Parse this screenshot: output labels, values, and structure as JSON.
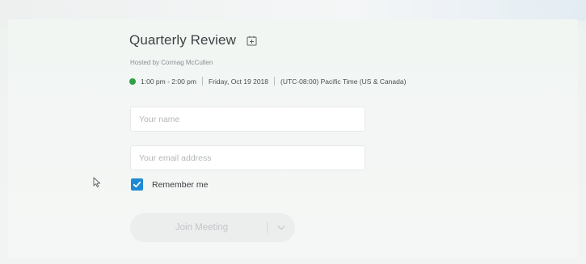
{
  "meeting": {
    "title": "Quarterly Review",
    "host": "Hosted by Cormag McCullen",
    "time_range": "1:00 pm - 2:00 pm",
    "date": "Friday, Oct 19 2018",
    "timezone": "(UTC-08:00) Pacific Time (US & Canada)",
    "status_color": "#2fa043"
  },
  "form": {
    "name_placeholder": "Your name",
    "name_value": "",
    "email_placeholder": "Your email address",
    "email_value": "",
    "remember_label": "Remember me",
    "remember_checked": true,
    "checkbox_color": "#1d8ad6"
  },
  "actions": {
    "join_label": "Join Meeting",
    "dropdown_icon": "chevron-down-icon"
  },
  "icons": {
    "title_icon": "add-to-calendar-icon",
    "pointer": "mouse-cursor-icon"
  }
}
